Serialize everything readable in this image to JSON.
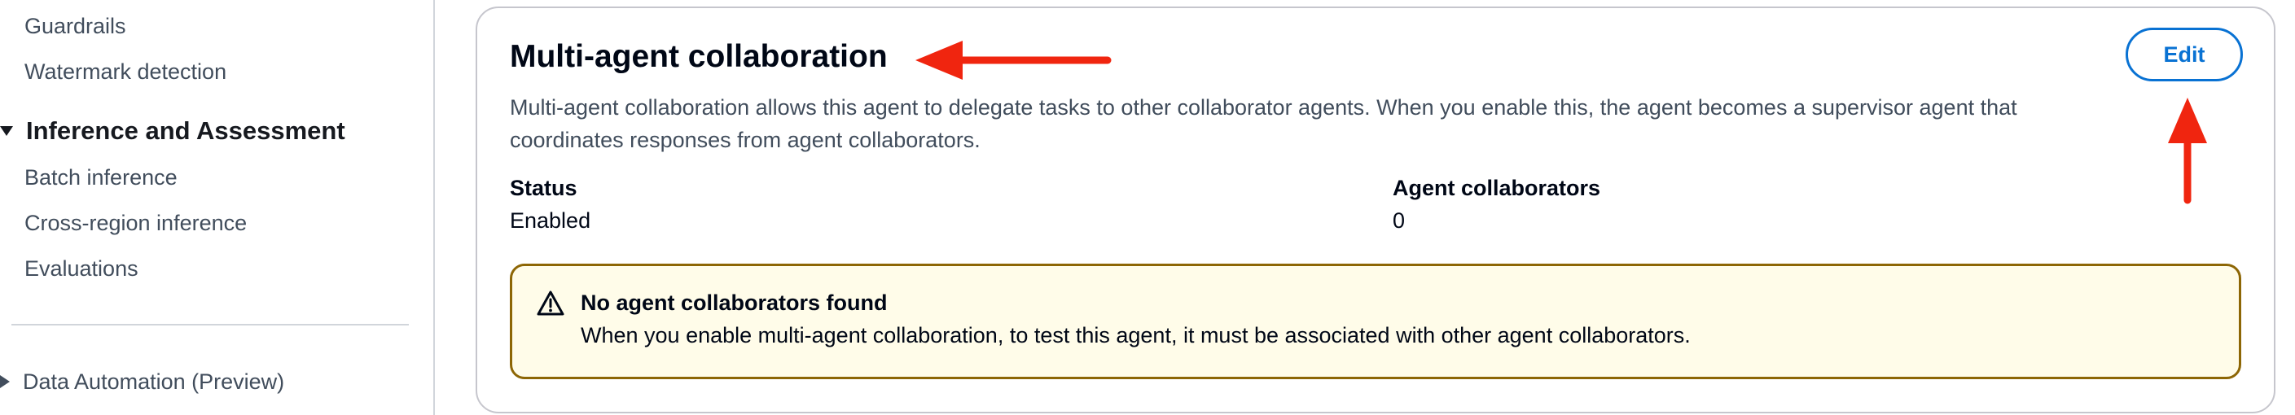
{
  "sidebar": {
    "top_items": [
      {
        "label": "Guardrails"
      },
      {
        "label": "Watermark detection"
      }
    ],
    "inference_section": {
      "label": "Inference and Assessment",
      "expanded": true,
      "items": [
        {
          "label": "Batch inference"
        },
        {
          "label": "Cross-region inference"
        },
        {
          "label": "Evaluations"
        }
      ]
    },
    "data_automation_section": {
      "label": "Data Automation (Preview)",
      "expanded": false
    }
  },
  "card": {
    "title": "Multi-agent collaboration",
    "edit_label": "Edit",
    "description": "Multi-agent collaboration allows this agent to delegate tasks to other collaborator agents. When you enable this, the agent becomes a supervisor agent that coordinates responses from agent collaborators.",
    "status": {
      "label": "Status",
      "value": "Enabled"
    },
    "agent_collaborators": {
      "label": "Agent collaborators",
      "value": "0"
    },
    "alert": {
      "icon": "warning-icon",
      "title": "No agent collaborators found",
      "message": "When you enable multi-agent collaboration, to test this agent, it must be associated with other agent collaborators."
    }
  },
  "colors": {
    "accent_blue": "#0972d3",
    "warning_border": "#8d6605",
    "warning_background": "#fffce9",
    "annotation_red": "#f0250f"
  }
}
